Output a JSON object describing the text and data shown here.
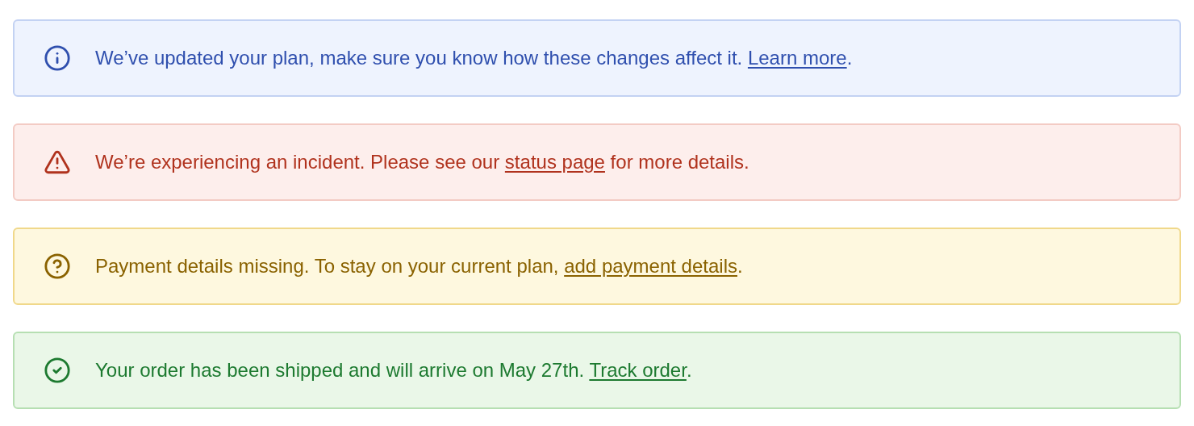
{
  "alerts": [
    {
      "kind": "info",
      "text_before": "We’ve updated your plan, make sure you know how these changes affect it. ",
      "link": "Learn more",
      "text_after": "."
    },
    {
      "kind": "error",
      "text_before": "We’re experiencing an incident. Please see our ",
      "link": "status page",
      "text_after": " for more details."
    },
    {
      "kind": "warning",
      "text_before": "Payment details missing. To stay on your current plan, ",
      "link": "add payment details",
      "text_after": "."
    },
    {
      "kind": "success",
      "text_before": "Your order has been shipped and will arrive on May 27th. ",
      "link": "Track order",
      "text_after": "."
    }
  ]
}
